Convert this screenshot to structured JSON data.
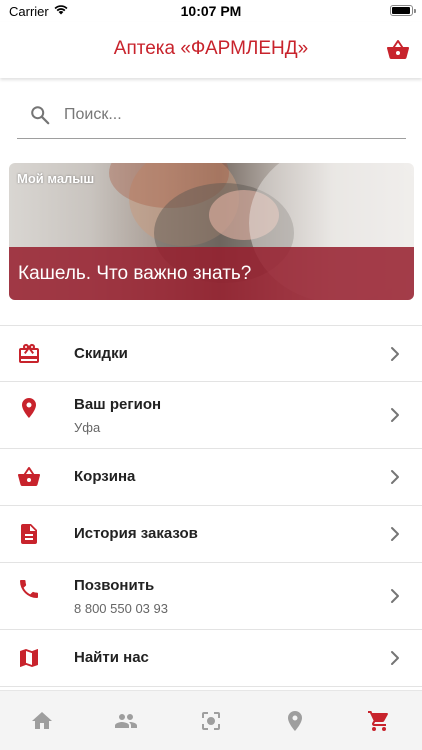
{
  "status_bar": {
    "carrier": "Carrier",
    "time": "10:07 PM"
  },
  "header": {
    "title": "Аптека «ФАРМЛЕНД»",
    "cart_icon": "basket-icon"
  },
  "search": {
    "placeholder": "Поиск...",
    "value": ""
  },
  "banner": {
    "category": "Мой малыш",
    "title": "Кашель. Что важно знать?"
  },
  "menu": {
    "items": [
      {
        "label": "Скидки",
        "icon": "gift-card-icon"
      },
      {
        "label": "Ваш регион",
        "sub": "Уфа",
        "icon": "location-pin-icon"
      },
      {
        "label": "Корзина",
        "icon": "basket-icon"
      },
      {
        "label": "История заказов",
        "icon": "document-icon"
      },
      {
        "label": "Позвонить",
        "sub": "8 800 550 03 93",
        "icon": "phone-icon"
      },
      {
        "label": "Найти нас",
        "icon": "map-icon"
      }
    ]
  },
  "tab_bar": {
    "tabs": [
      "home-icon",
      "people-icon",
      "scan-icon",
      "location-icon",
      "cart-icon"
    ],
    "active": "cart-icon"
  },
  "colors": {
    "accent": "#c8232c",
    "banner_caption": "#961e2d",
    "tab_inactive": "#9e9e9e"
  }
}
